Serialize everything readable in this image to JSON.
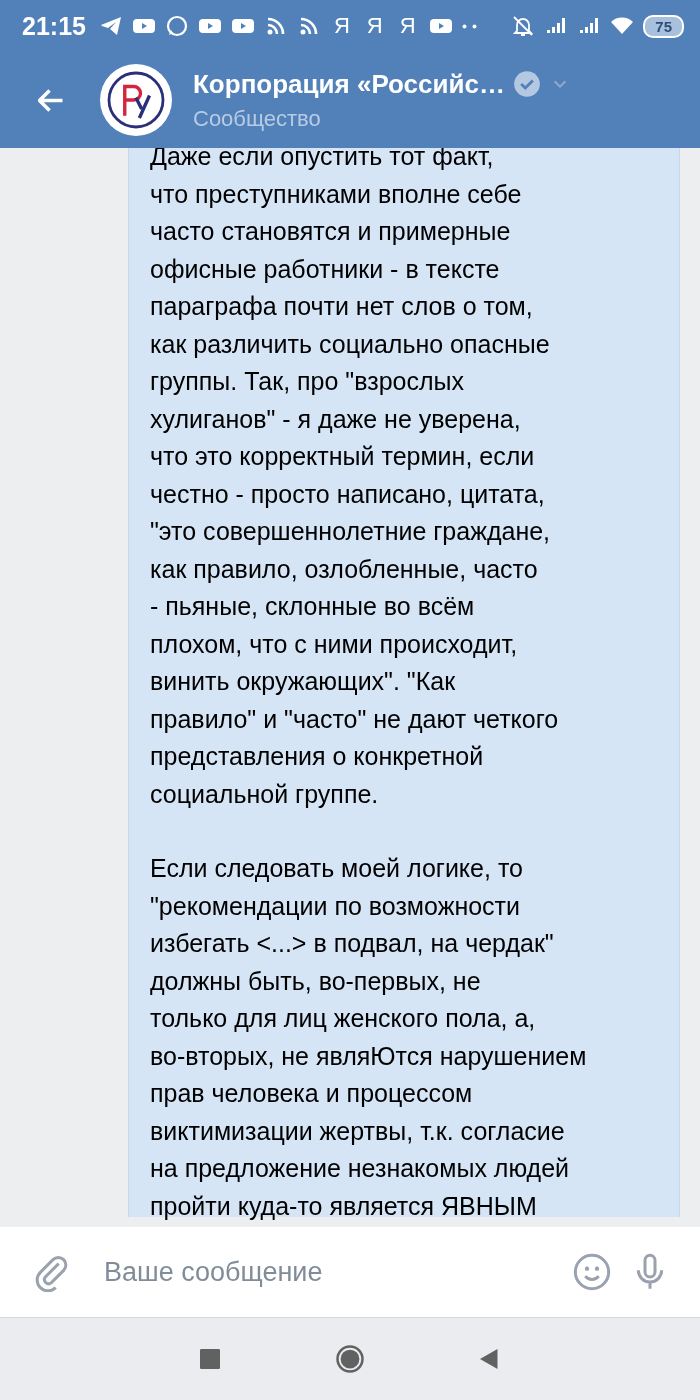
{
  "status_bar": {
    "time": "21:15",
    "notifications": [
      {
        "kind": "telegram"
      },
      {
        "kind": "youtube"
      },
      {
        "kind": "whatsapp"
      },
      {
        "kind": "youtube"
      },
      {
        "kind": "youtube"
      },
      {
        "kind": "rss"
      },
      {
        "kind": "rss"
      },
      {
        "kind": "letter",
        "text": "Я"
      },
      {
        "kind": "letter",
        "text": "Я"
      },
      {
        "kind": "letter",
        "text": "Я"
      },
      {
        "kind": "youtube"
      },
      {
        "kind": "more"
      }
    ],
    "battery": "75"
  },
  "header": {
    "title": "Корпорация «Российс…",
    "subtitle": "Сообщество",
    "verified": true
  },
  "message": {
    "paragraphs": [
      {
        "lines": [
          "Даже если опустить тот факт,",
          "что преступниками вполне себе",
          "часто становятся и примерные",
          "офисные работники - в тексте",
          "параграфа почти нет слов о том,",
          "как различить социально опасные",
          "группы. Так, про \"взрослых",
          "хулиганов\" - я даже не уверена,",
          "что это корректный термин, если",
          "честно - просто написано, цитата,",
          "\"это совершеннолетние граждане,",
          "как правило, озлобленные, часто",
          "- пьяные, склонные во всём",
          "плохом, что с ними происходит,",
          "винить окружающих\". \"Как",
          "правило\" и \"часто\" не дают четкого",
          "представления о конкретной",
          "социальной группе."
        ]
      },
      {
        "lines": [
          "Если следовать моей логике, то",
          "\"рекомендации по возможности",
          "избегать <...> в подвал, на чердак\"",
          "должны быть, во-первых, не",
          "только для лиц женского пола, а,",
          "во-вторых, не являЮтся нарушением",
          "прав человека и процессом",
          "виктимизации жертвы, т.к. согласие",
          "на предложение незнакомых людей",
          "пройти куда-то является ЯВНЫМ"
        ]
      }
    ]
  },
  "composer": {
    "placeholder": "Ваше сообщение"
  }
}
